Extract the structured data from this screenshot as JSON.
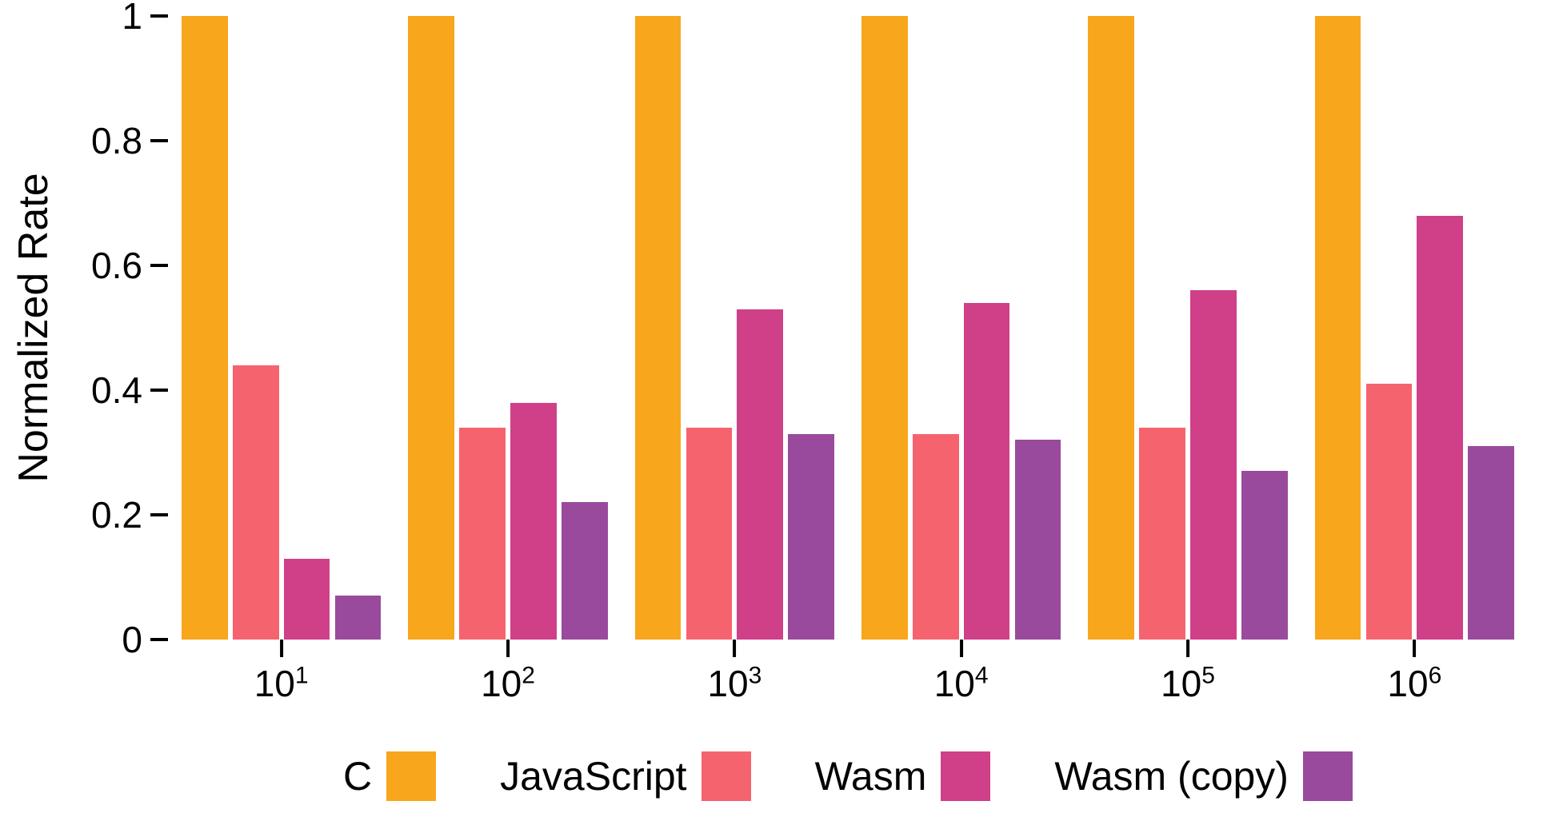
{
  "chart_data": {
    "type": "bar",
    "ylabel": "Normalized Rate",
    "xlabel": "",
    "ylim": [
      0,
      1
    ],
    "y_ticks": [
      0,
      0.2,
      0.4,
      0.6,
      0.8,
      1
    ],
    "categories": [
      "10^1",
      "10^2",
      "10^3",
      "10^4",
      "10^5",
      "10^6"
    ],
    "series": [
      {
        "name": "C",
        "color": "#f8a61b",
        "values": [
          1.0,
          1.0,
          1.0,
          1.0,
          1.0,
          1.0
        ]
      },
      {
        "name": "JavaScript",
        "color": "#f5636f",
        "values": [
          0.44,
          0.34,
          0.34,
          0.33,
          0.34,
          0.41
        ]
      },
      {
        "name": "Wasm",
        "color": "#cf4088",
        "values": [
          0.13,
          0.38,
          0.53,
          0.54,
          0.56,
          0.68
        ]
      },
      {
        "name": "Wasm (copy)",
        "color": "#9a4a9c",
        "values": [
          0.07,
          0.22,
          0.33,
          0.32,
          0.27,
          0.31
        ]
      }
    ],
    "legend_position": "bottom",
    "grid": false
  }
}
